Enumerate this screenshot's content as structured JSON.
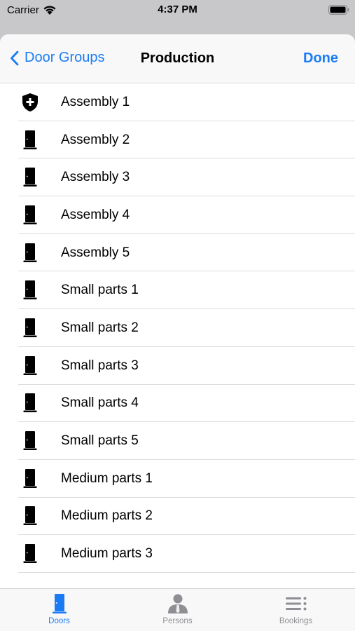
{
  "status_bar": {
    "carrier": "Carrier",
    "time": "4:37 PM"
  },
  "nav": {
    "back_label": "Door Groups",
    "title": "Production",
    "done_label": "Done"
  },
  "doors": [
    {
      "label": "Assembly 1",
      "icon": "shield-plus-icon"
    },
    {
      "label": "Assembly 2",
      "icon": "door-icon"
    },
    {
      "label": "Assembly 3",
      "icon": "door-icon"
    },
    {
      "label": "Assembly 4",
      "icon": "door-icon"
    },
    {
      "label": "Assembly 5",
      "icon": "door-icon"
    },
    {
      "label": "Small parts 1",
      "icon": "door-icon"
    },
    {
      "label": "Small parts 2",
      "icon": "door-icon"
    },
    {
      "label": "Small parts 3",
      "icon": "door-icon"
    },
    {
      "label": "Small parts 4",
      "icon": "door-icon"
    },
    {
      "label": "Small parts 5",
      "icon": "door-icon"
    },
    {
      "label": "Medium parts 1",
      "icon": "door-icon"
    },
    {
      "label": "Medium parts 2",
      "icon": "door-icon"
    },
    {
      "label": "Medium parts 3",
      "icon": "door-icon"
    }
  ],
  "tabs": [
    {
      "label": "Doors",
      "icon": "door-tab-icon",
      "selected": true
    },
    {
      "label": "Persons",
      "icon": "person-tab-icon",
      "selected": false
    },
    {
      "label": "Bookings",
      "icon": "list-tab-icon",
      "selected": false
    }
  ],
  "colors": {
    "accent": "#1a7cf5",
    "inactive_tab": "#8e8e93"
  }
}
